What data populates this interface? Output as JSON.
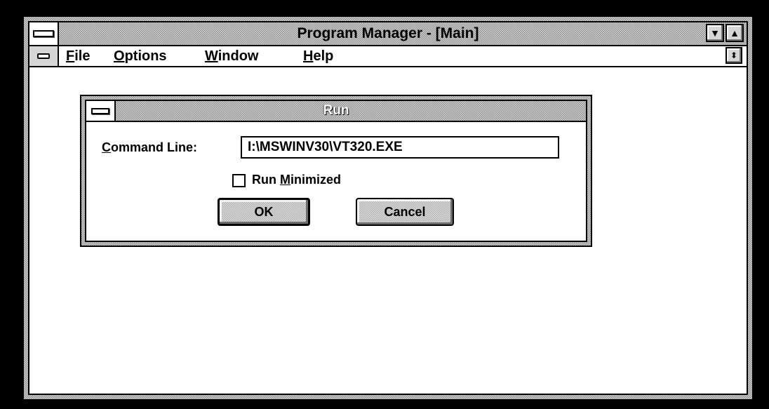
{
  "window": {
    "title": "Program Manager - [Main]"
  },
  "menubar": {
    "items": [
      {
        "mnemonic": "F",
        "rest": "ile"
      },
      {
        "mnemonic": "O",
        "rest": "ptions"
      },
      {
        "mnemonic": "W",
        "rest": "indow"
      },
      {
        "mnemonic": "H",
        "rest": "elp"
      }
    ]
  },
  "dialog": {
    "title": "Run",
    "command_label": {
      "mnemonic": "C",
      "rest": "ommand Line:"
    },
    "command_value": "I:\\MSWINV30\\VT320.EXE",
    "run_minimized": {
      "prefix": "Run ",
      "mnemonic": "M",
      "rest": "inimized",
      "checked": false
    },
    "ok_label": "OK",
    "cancel_label": "Cancel"
  },
  "icons": {
    "system_menu": "system-menu-icon",
    "minimize": "minimize-arrow-icon",
    "maximize": "maximize-arrow-icon",
    "restore": "restore-arrows-icon"
  }
}
